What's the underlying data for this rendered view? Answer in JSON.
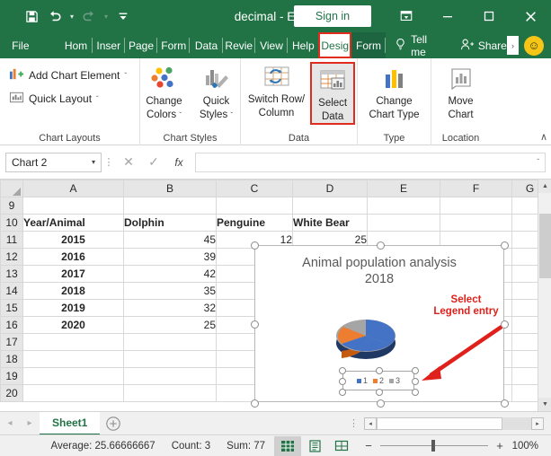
{
  "titlebar": {
    "document_title": "decimal  -  Excel",
    "signin_label": "Sign in",
    "qat": [
      {
        "name": "save-icon",
        "label": "Save"
      },
      {
        "name": "undo-icon",
        "label": "Undo"
      },
      {
        "name": "redo-icon",
        "label": "Redo"
      },
      {
        "name": "customize-qat-icon",
        "label": "Customize Quick Access Toolbar"
      }
    ],
    "window": [
      {
        "name": "ribbon-display-options-icon",
        "label": "Ribbon Display Options"
      },
      {
        "name": "minimize-icon",
        "label": "Minimize"
      },
      {
        "name": "maximize-icon",
        "label": "Maximize"
      },
      {
        "name": "close-icon",
        "label": "Close"
      }
    ]
  },
  "tabs": {
    "items": [
      {
        "id": "file",
        "label": "File"
      },
      {
        "id": "home",
        "label": "Hom"
      },
      {
        "id": "insert",
        "label": "Inser"
      },
      {
        "id": "page",
        "label": "Page"
      },
      {
        "id": "formulas",
        "label": "Form"
      },
      {
        "id": "data",
        "label": "Data"
      },
      {
        "id": "review",
        "label": "Revie"
      },
      {
        "id": "view",
        "label": "View"
      },
      {
        "id": "help",
        "label": "Help"
      },
      {
        "id": "design",
        "label": "Desig"
      },
      {
        "id": "format",
        "label": "Form"
      }
    ],
    "active_id": "design",
    "tellme_label": "Tell me",
    "share_label": "Share",
    "more_label": "›"
  },
  "ribbon": {
    "groups": [
      {
        "id": "chart-layouts",
        "label": "Chart Layouts",
        "small_buttons": [
          {
            "id": "add-chart-element",
            "label": "Add Chart Element",
            "caret": "ˇ"
          },
          {
            "id": "quick-layout",
            "label": "Quick Layout",
            "caret": "ˇ"
          }
        ]
      },
      {
        "id": "chart-styles",
        "label": "Chart Styles",
        "buttons": [
          {
            "id": "change-colors",
            "line1": "Change",
            "line2": "Colors",
            "caret": "ˇ"
          },
          {
            "id": "quick-styles",
            "line1": "Quick",
            "line2": "Styles",
            "caret": "ˇ"
          }
        ]
      },
      {
        "id": "data",
        "label": "Data",
        "buttons": [
          {
            "id": "switch-row-column",
            "line1": "Switch Row/",
            "line2": "Column",
            "caret": ""
          },
          {
            "id": "select-data",
            "line1": "Select",
            "line2": "Data",
            "caret": "",
            "selected": true
          }
        ]
      },
      {
        "id": "type",
        "label": "Type",
        "buttons": [
          {
            "id": "change-chart-type",
            "line1": "Change",
            "line2": "Chart Type",
            "caret": ""
          }
        ]
      },
      {
        "id": "location",
        "label": "Location",
        "buttons": [
          {
            "id": "move-chart",
            "line1": "Move",
            "line2": "Chart",
            "caret": ""
          }
        ]
      }
    ],
    "collapse_label": "∧"
  },
  "formula_bar": {
    "name_box_value": "Chart 2",
    "name_box_caret": "▾",
    "cancel_label": "✕",
    "enter_label": "✓",
    "function_label": "fx",
    "formula_value": "",
    "expand_caret": "ˇ"
  },
  "grid": {
    "columns": [
      "A",
      "B",
      "C",
      "D",
      "E",
      "F",
      "G"
    ],
    "rows": [
      {
        "header": "9",
        "cells": [
          "",
          "",
          "",
          "",
          "",
          "",
          ""
        ]
      },
      {
        "header": "10",
        "cells": [
          "Year/Animal",
          "Dolphin",
          "Penguine",
          "White Bear",
          "",
          "",
          ""
        ],
        "styles": [
          "b",
          "b",
          "b",
          "b",
          "",
          "",
          ""
        ]
      },
      {
        "header": "11",
        "cells": [
          "2015",
          "45",
          "12",
          "25",
          "",
          "",
          ""
        ],
        "styles": [
          "b c",
          "r",
          "r",
          "r",
          "",
          "",
          ""
        ]
      },
      {
        "header": "12",
        "cells": [
          "2016",
          "39",
          "",
          "",
          "",
          "",
          ""
        ],
        "styles": [
          "b c",
          "r",
          "",
          "",
          "",
          "",
          ""
        ]
      },
      {
        "header": "13",
        "cells": [
          "2017",
          "42",
          "",
          "",
          "",
          "",
          ""
        ],
        "styles": [
          "b c",
          "r",
          "",
          "",
          "",
          "",
          ""
        ]
      },
      {
        "header": "14",
        "cells": [
          "2018",
          "35",
          "",
          "",
          "",
          "",
          ""
        ],
        "styles": [
          "b c",
          "r",
          "",
          "",
          "",
          "",
          ""
        ]
      },
      {
        "header": "15",
        "cells": [
          "2019",
          "32",
          "",
          "",
          "",
          "",
          ""
        ],
        "styles": [
          "b c",
          "r",
          "",
          "",
          "",
          "",
          ""
        ]
      },
      {
        "header": "16",
        "cells": [
          "2020",
          "25",
          "",
          "",
          "",
          "",
          ""
        ],
        "styles": [
          "b c",
          "r",
          "",
          "",
          "",
          "",
          ""
        ]
      },
      {
        "header": "17",
        "cells": [
          "",
          "",
          "",
          "",
          "",
          "",
          ""
        ]
      },
      {
        "header": "18",
        "cells": [
          "",
          "",
          "",
          "",
          "",
          "",
          ""
        ]
      },
      {
        "header": "19",
        "cells": [
          "",
          "",
          "",
          "",
          "",
          "",
          ""
        ]
      },
      {
        "header": "20",
        "cells": [
          "",
          "",
          "",
          "",
          "",
          "",
          ""
        ]
      }
    ]
  },
  "chart": {
    "title_line1": "Animal population analysis",
    "title_line2": "2018",
    "colors": {
      "series1": "#4472c4",
      "series2": "#ed7d31",
      "series3": "#a5a5a5"
    },
    "legend": [
      {
        "label": "1",
        "color": "#4472c4"
      },
      {
        "label": "2",
        "color": "#ed7d31"
      },
      {
        "label": "3",
        "color": "#a5a5a5"
      }
    ]
  },
  "chart_data": {
    "type": "pie",
    "title": "Animal population analysis 2018",
    "categories": [
      "1",
      "2",
      "3"
    ],
    "labels": [
      "Dolphin",
      "Penguine",
      "White Bear"
    ],
    "values": [
      35,
      12,
      25
    ],
    "colors": [
      "#4472c4",
      "#ed7d31",
      "#a5a5a5"
    ],
    "legend_position": "bottom",
    "three_d": true,
    "grid": false
  },
  "annotation": {
    "line1": "Select",
    "line2": "Legend entry",
    "color": "#e0201b"
  },
  "sheet_tabs": {
    "prev_label": "◂",
    "next_label": "▸",
    "tabs": [
      {
        "label": "Sheet1",
        "active": true
      }
    ],
    "add_label": "+",
    "menu_dots": "⋮",
    "hscroll_left": "◂",
    "hscroll_right": "▸"
  },
  "status_bar": {
    "average_label": "Average: 25.66666667",
    "count_label": "Count: 3",
    "sum_label": "Sum: 77",
    "views": [
      {
        "id": "normal",
        "name": "normal-view-icon",
        "active": true
      },
      {
        "id": "page-layout",
        "name": "page-layout-view-icon",
        "active": false
      },
      {
        "id": "page-break",
        "name": "page-break-view-icon",
        "active": false
      }
    ],
    "zoom_out": "−",
    "zoom_in": "+",
    "zoom_level": "100%"
  }
}
